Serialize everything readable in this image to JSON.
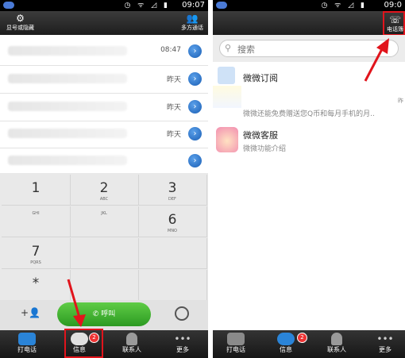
{
  "left": {
    "status": {
      "time": "09:07",
      "icons": "◷ ᯤ ◿ ▮"
    },
    "header": {
      "hide_number_label": "显号或隐藏",
      "conference_label": "多方通话",
      "gear": "⚙",
      "people": "👥"
    },
    "call_log": [
      {
        "time": "08:47"
      },
      {
        "time": "昨天"
      },
      {
        "time": "昨天"
      },
      {
        "time": "昨天"
      },
      {
        "time": ""
      }
    ],
    "keypad": [
      {
        "num": "1",
        "sub": ""
      },
      {
        "num": "2",
        "sub": "ABC"
      },
      {
        "num": "3",
        "sub": "DEF"
      },
      {
        "num": "",
        "sub": "GHI"
      },
      {
        "num": "",
        "sub": "JKL"
      },
      {
        "num": "6",
        "sub": "MNO"
      },
      {
        "num": "7",
        "sub": "PQRS"
      },
      {
        "num": "",
        "sub": ""
      },
      {
        "num": "",
        "sub": ""
      },
      {
        "num": "*",
        "sub": ""
      },
      {
        "num": "",
        "sub": ""
      },
      {
        "num": "",
        "sub": ""
      }
    ],
    "actions": {
      "add_contact": "+👤",
      "call_label": "呼叫",
      "voicemail": "◎"
    },
    "nav": [
      {
        "label": "打电话"
      },
      {
        "label": "信息",
        "badge": "2"
      },
      {
        "label": "联系人"
      },
      {
        "label": "更多"
      }
    ]
  },
  "right": {
    "status": {
      "time": "09:0"
    },
    "header": {
      "phonebook_label": "电话簿"
    },
    "search": {
      "placeholder": "搜索",
      "icon": "⚲"
    },
    "messages": [
      {
        "name": "微微订阅",
        "preview": "微微还能免费赠送您Q币和每月手机的月..",
        "time": "昨"
      },
      {
        "name": "微微客服",
        "preview": "微微功能介绍"
      }
    ],
    "nav": [
      {
        "label": "打电话"
      },
      {
        "label": "信息",
        "badge": "2"
      },
      {
        "label": "联系人"
      },
      {
        "label": "更多"
      }
    ]
  },
  "colors": {
    "highlight": "#e1141c",
    "call_green": "#3cae2e",
    "nav_blue": "#2a84d8"
  }
}
